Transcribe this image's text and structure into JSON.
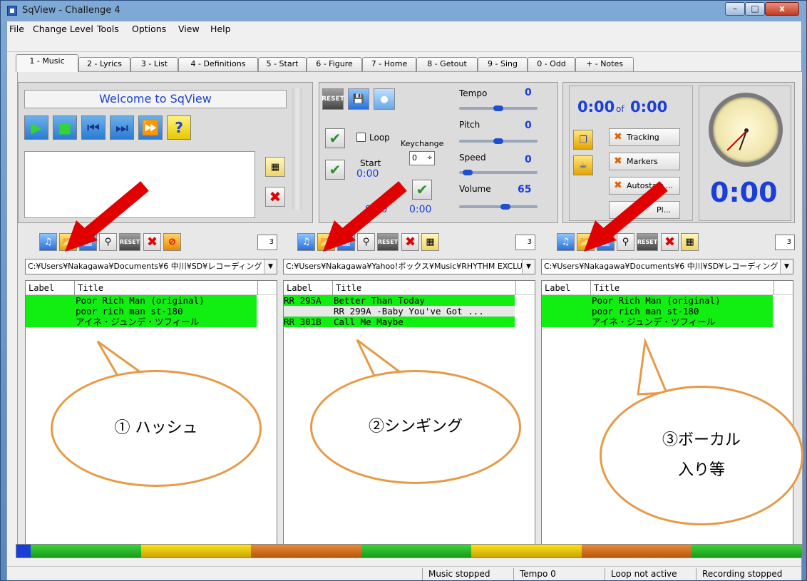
{
  "window": {
    "title": "SqView - Challenge 4",
    "min": "–",
    "max": "□",
    "close": "x"
  },
  "menu": [
    "File",
    "Change Level",
    "Tools",
    "Options",
    "View",
    "Help"
  ],
  "tabs": [
    "1 - Music",
    "2 - Lyrics",
    "3 - List",
    "4 - Definitions",
    "5 - Start",
    "6 - Figure",
    "7 - Home",
    "8 - Getout",
    "9 - Sing",
    "0 - Odd",
    "+ - Notes"
  ],
  "player": {
    "welcome": "Welcome to SqView",
    "help": "?"
  },
  "controls": {
    "reset": "RESET",
    "loop": "Loop",
    "keychange_label": "Keychange",
    "keychange_value": "0",
    "start_label": "Start",
    "start_value": "0:00",
    "end_value": "0:00",
    "end_value2": "0:00",
    "tempo_label": "Tempo",
    "tempo_value": "0",
    "pitch_label": "Pitch",
    "pitch_value": "0",
    "speed_label": "Speed",
    "speed_value": "0",
    "volume_label": "Volume",
    "volume_value": "65"
  },
  "sliders": {
    "tempo": 0.5,
    "pitch": 0.5,
    "speed": 0.05,
    "volume": 0.6
  },
  "timer": {
    "current": "0:00",
    "of": "of",
    "total": "0:00",
    "big": "0:00"
  },
  "toggles": [
    "Tracking",
    "Markers",
    "Autostart ...",
    "Pl..."
  ],
  "lists": [
    {
      "count": "3",
      "path": "C:¥Users¥Nakagawa¥Documents¥6 中川¥SD¥レコーディング",
      "col_label": "Label",
      "col_title": "Title",
      "rows": [
        {
          "label": "",
          "title": "Poor Rich Man  (original)",
          "green": true
        },
        {
          "label": "",
          "title": "poor rich man  st-180",
          "green": true
        },
        {
          "label": "",
          "title": "アイネ・ジュンデ・ツフィール",
          "green": true
        }
      ]
    },
    {
      "count": "3",
      "path": "C:¥Users¥Nakagawa¥Yahoo!ボックス¥Music¥RHYTHM EXCLUS",
      "col_label": "Label",
      "col_title": "Title",
      "rows": [
        {
          "label": "RR 295A",
          "title": "Better Than  Today",
          "green": true
        },
        {
          "label": "",
          "title": "RR 299A -Baby You've Got ...",
          "green": false
        },
        {
          "label": "RR 301B",
          "title": "Call Me Maybe",
          "green": true
        }
      ]
    },
    {
      "count": "3",
      "path": "C:¥Users¥Nakagawa¥Documents¥6 中川¥SD¥レコーディング",
      "col_label": "Label",
      "col_title": "Title",
      "rows": [
        {
          "label": "",
          "title": "Poor Rich Man  (original)",
          "green": true
        },
        {
          "label": "",
          "title": "poor rich man  st-180",
          "green": true
        },
        {
          "label": "",
          "title": "アイネ・ジュンデ・ツフィール",
          "green": true
        }
      ]
    }
  ],
  "bubbles": [
    "①  ハッシュ",
    "②シンギング",
    "③ボーカル",
    "入り等"
  ],
  "status": [
    "Music stopped",
    "Tempo 0",
    "Loop not active",
    "Recording stopped"
  ],
  "colors": {
    "row_green": "#11ee11",
    "accent_blue": "#1a3fd8",
    "arrow_red": "#e00000",
    "bubble_orange": "#e79a45"
  }
}
